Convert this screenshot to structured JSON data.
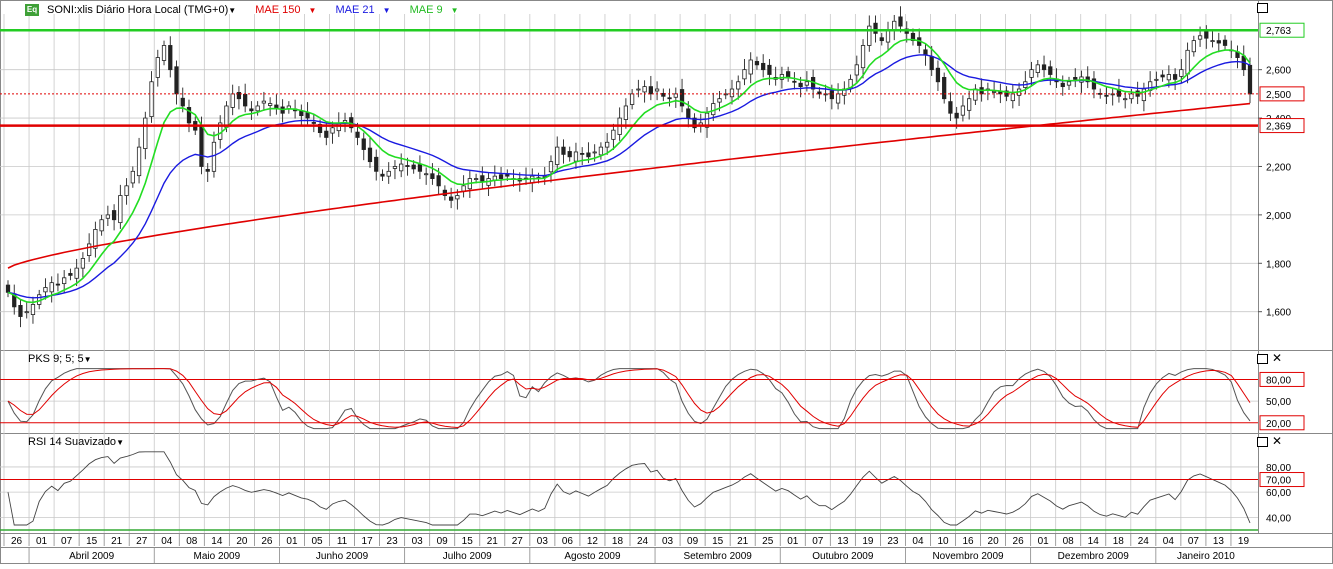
{
  "header": {
    "main": {
      "symbol_label": "SONI:xlis Diário Hora Local (TMG+0)",
      "icon": "eq-icon",
      "icon_text": "Eq",
      "indicators": [
        {
          "label": "MAE 150",
          "color": "#e00000"
        },
        {
          "label": "MAE 21",
          "color": "#1a1ae0"
        },
        {
          "label": "MAE 9",
          "color": "#22dd22"
        }
      ]
    },
    "pks": {
      "label": "PKS 9; 5; 5"
    },
    "rsi": {
      "label": "RSI 14 Suavizado"
    }
  },
  "colors": {
    "ma150": "#e00000",
    "ma21": "#1a1ae0",
    "ma9": "#22dd22",
    "hline_green": "#22cc22",
    "hline_red": "#e00000",
    "candle": "#222222",
    "grid": "#c8c8c8"
  },
  "chart_data": [
    {
      "type": "candlestick",
      "title": "SONI:xlis Diário Hora Local (TMG+0)",
      "ylim": [
        1.45,
        2.83
      ],
      "yticks": [
        "1,600",
        "1,800",
        "2,000",
        "2,200",
        "2,400",
        "2,600"
      ],
      "highlight_labels": [
        {
          "label": "2,763",
          "value": 2.763,
          "color": "#22cc22"
        },
        {
          "label": "2,500",
          "value": 2.5,
          "color": "#e00000"
        },
        {
          "label": "2,369",
          "value": 2.369,
          "color": "#e00000"
        }
      ],
      "hlines": [
        {
          "value": 2.763,
          "color": "#22cc22",
          "style": "solid"
        },
        {
          "value": 2.369,
          "color": "#e00000",
          "style": "solid"
        },
        {
          "value": 2.5,
          "color": "#e00000",
          "style": "dotted"
        }
      ],
      "grid": true,
      "series_closes": [
        1.68,
        1.62,
        1.58,
        1.6,
        1.63,
        1.67,
        1.7,
        1.72,
        1.71,
        1.74,
        1.75,
        1.78,
        1.82,
        1.88,
        1.94,
        1.98,
        2.0,
        1.98,
        2.08,
        2.12,
        2.18,
        2.28,
        2.4,
        2.55,
        2.65,
        2.7,
        2.6,
        2.5,
        2.45,
        2.38,
        2.35,
        2.2,
        2.18,
        2.3,
        2.38,
        2.45,
        2.5,
        2.48,
        2.45,
        2.43,
        2.45,
        2.47,
        2.46,
        2.44,
        2.42,
        2.45,
        2.43,
        2.41,
        2.4,
        2.38,
        2.34,
        2.32,
        2.36,
        2.38,
        2.39,
        2.36,
        2.32,
        2.27,
        2.22,
        2.18,
        2.16,
        2.18,
        2.2,
        2.21,
        2.2,
        2.19,
        2.18,
        2.17,
        2.15,
        2.12,
        2.08,
        2.06,
        2.08,
        2.12,
        2.15,
        2.15,
        2.14,
        2.15,
        2.16,
        2.15,
        2.16,
        2.15,
        2.14,
        2.15,
        2.16,
        2.15,
        2.16,
        2.22,
        2.28,
        2.25,
        2.24,
        2.26,
        2.25,
        2.24,
        2.26,
        2.28,
        2.3,
        2.35,
        2.4,
        2.45,
        2.5,
        2.52,
        2.53,
        2.5,
        2.52,
        2.49,
        2.48,
        2.5,
        2.45,
        2.4,
        2.36,
        2.38,
        2.42,
        2.46,
        2.48,
        2.5,
        2.52,
        2.55,
        2.6,
        2.64,
        2.62,
        2.6,
        2.58,
        2.56,
        2.58,
        2.57,
        2.55,
        2.53,
        2.55,
        2.52,
        2.5,
        2.5,
        2.48,
        2.5,
        2.52,
        2.56,
        2.62,
        2.7,
        2.78,
        2.75,
        2.72,
        2.76,
        2.8,
        2.78,
        2.75,
        2.72,
        2.7,
        2.66,
        2.6,
        2.55,
        2.48,
        2.42,
        2.4,
        2.45,
        2.48,
        2.52,
        2.5,
        2.52,
        2.51,
        2.5,
        2.49,
        2.5,
        2.52,
        2.55,
        2.6,
        2.62,
        2.6,
        2.58,
        2.55,
        2.53,
        2.55,
        2.56,
        2.57,
        2.55,
        2.52,
        2.5,
        2.49,
        2.5,
        2.49,
        2.48,
        2.5,
        2.49,
        2.52,
        2.55,
        2.56,
        2.57,
        2.58,
        2.56,
        2.6,
        2.68,
        2.72,
        2.74,
        2.73,
        2.72,
        2.71,
        2.7,
        2.68,
        2.65,
        2.6,
        2.5
      ],
      "ma150_start": 1.78,
      "ma150_end": 2.46
    },
    {
      "type": "line",
      "title": "PKS 9; 5; 5",
      "ylim": [
        10,
        100
      ],
      "yticks": [
        "50,00"
      ],
      "highlight_labels": [
        {
          "label": "80,00",
          "value": 80,
          "color": "#e00000"
        },
        {
          "label": "20,00",
          "value": 20,
          "color": "#e00000"
        }
      ],
      "series": [
        {
          "color": "#555555"
        },
        {
          "color": "#e00000"
        }
      ]
    },
    {
      "type": "line",
      "title": "RSI 14 Suavizado",
      "ylim": [
        30,
        95
      ],
      "yticks": [
        "80,00",
        "60,00",
        "40,00"
      ],
      "highlight_labels": [
        {
          "label": "70,00",
          "value": 70,
          "color": "#e00000"
        }
      ],
      "series": [
        {
          "color": "#444444"
        }
      ]
    }
  ],
  "xaxis": {
    "day_labels": [
      "26",
      "01",
      "07",
      "15",
      "21",
      "27",
      "04",
      "08",
      "14",
      "20",
      "26",
      "01",
      "05",
      "11",
      "17",
      "23",
      "03",
      "09",
      "15",
      "21",
      "27",
      "03",
      "06",
      "12",
      "18",
      "24",
      "03",
      "09",
      "15",
      "21",
      "25",
      "01",
      "07",
      "13",
      "19",
      "23",
      "04",
      "10",
      "16",
      "20",
      "26",
      "01",
      "08",
      "14",
      "18",
      "24",
      "04",
      "07",
      "13",
      "19"
    ],
    "month_labels": [
      "Abril 2009",
      "Maio 2009",
      "Junho 2009",
      "Julho 2009",
      "Agosto 2009",
      "Setembro 2009",
      "Outubro 2009",
      "Novembro 2009",
      "Dezembro 2009",
      "Janeiro 2010"
    ]
  }
}
